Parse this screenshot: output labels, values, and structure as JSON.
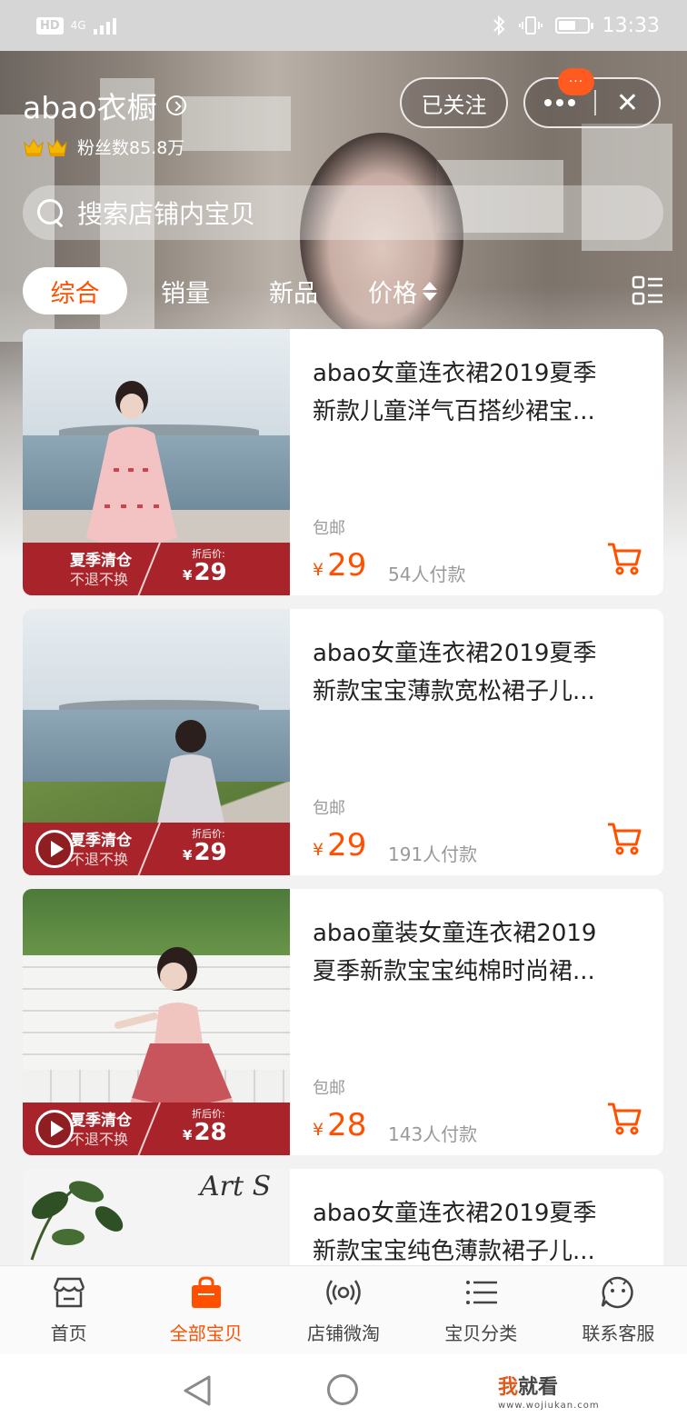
{
  "status_bar": {
    "hd": "HD",
    "network": "4G",
    "time": "13:33"
  },
  "shop": {
    "name": "abao衣橱",
    "fans_label": "粉丝数85.8万",
    "follow_label": "已关注",
    "badge_text": "···",
    "close_glyph": "✕"
  },
  "search": {
    "placeholder": "搜索店铺内宝贝"
  },
  "tabs": {
    "all": "综合",
    "sales": "销量",
    "new": "新品",
    "price": "价格"
  },
  "products": [
    {
      "title_line1": "abao女童连衣裙2019夏季",
      "title_line2": "新款儿童洋气百搭纱裙宝...",
      "shipping": "包邮",
      "price": "29",
      "sold": "54人付款",
      "banner_title": "夏季清仓",
      "banner_sub": "不退不换",
      "banner_label": "折后价:",
      "banner_price": "29",
      "has_video": false
    },
    {
      "title_line1": "abao女童连衣裙2019夏季",
      "title_line2": "新款宝宝薄款宽松裙子儿...",
      "shipping": "包邮",
      "price": "29",
      "sold": "191人付款",
      "banner_title": "夏季清仓",
      "banner_sub": "不退不换",
      "banner_label": "折后价:",
      "banner_price": "29",
      "has_video": true
    },
    {
      "title_line1": "abao童装女童连衣裙2019",
      "title_line2": "夏季新款宝宝纯棉时尚裙...",
      "shipping": "包邮",
      "price": "28",
      "sold": "143人付款",
      "banner_title": "夏季清仓",
      "banner_sub": "不退不换",
      "banner_label": "折后价:",
      "banner_price": "28",
      "has_video": true
    },
    {
      "title_line1": "abao女童连衣裙2019夏季",
      "title_line2": "新款宝宝纯色薄款裙子儿...",
      "thumb_text": "Art S"
    }
  ],
  "currency": "¥",
  "bottom_nav": [
    {
      "label": "首页",
      "icon": "store-icon"
    },
    {
      "label": "全部宝贝",
      "icon": "shopping-bag-icon",
      "active": true
    },
    {
      "label": "店铺微淘",
      "icon": "broadcast-icon"
    },
    {
      "label": "宝贝分类",
      "icon": "list-icon"
    },
    {
      "label": "联系客服",
      "icon": "chat-face-icon"
    }
  ],
  "watermark": {
    "red": "我",
    "black": "就看",
    "url": "www.wojiukan.com"
  },
  "colors": {
    "accent": "#ff5000",
    "banner": "#a8242a"
  }
}
